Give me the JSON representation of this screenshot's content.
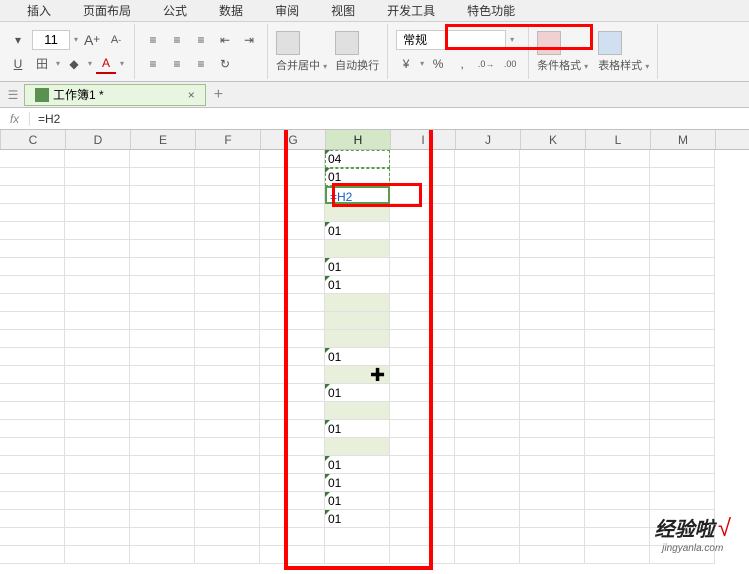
{
  "menu": {
    "items": [
      "插入",
      "页面布局",
      "公式",
      "数据",
      "审阅",
      "视图",
      "开发工具",
      "特色功能"
    ]
  },
  "ribbon": {
    "font_size": "11",
    "merge_label": "合并居中",
    "wrap_label": "自动换行",
    "format_value": "常规",
    "cond_format": "条件格式",
    "table_style": "表格样式"
  },
  "tabs": {
    "workbook_name": "工作簿1 *"
  },
  "formula": {
    "fx": "fx",
    "value": "=H2"
  },
  "columns": [
    "C",
    "D",
    "E",
    "F",
    "G",
    "H",
    "I",
    "J",
    "K",
    "L",
    "M"
  ],
  "cells": {
    "h_values": [
      "04",
      "01",
      "=H2",
      "",
      "01",
      "",
      "01",
      "01",
      "",
      "",
      "",
      "01",
      "",
      "01",
      "",
      "01",
      "",
      "01",
      "01",
      "01",
      "01"
    ],
    "edit_value": "=H2"
  },
  "watermark": {
    "main": "经验啦",
    "check": "√",
    "sub": "jingyanla.com"
  },
  "icons": {
    "increase_font": "A",
    "decrease_font": "A",
    "underline": "U",
    "border": "田",
    "fill": "◆",
    "font_color": "A",
    "align_left": "≡",
    "align_center": "≡",
    "align_right": "≡",
    "increase_indent": "→",
    "merge": "⊞",
    "wrap": "↵",
    "currency": "¤",
    "percent": "%",
    "decimal1": ".0",
    "decimal2": ".00"
  }
}
